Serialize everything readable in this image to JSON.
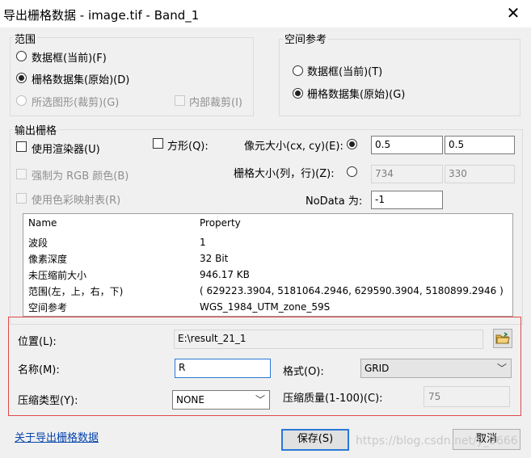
{
  "window": {
    "title": "导出栅格数据 - image.tif - Band_1",
    "close_glyph": "✕"
  },
  "extent": {
    "label": "范围",
    "data_frame": "数据框(当前)(F)",
    "raster_dataset": "栅格数据集(原始)(D)",
    "selected_graphics": "所选图形(裁剪)(G)",
    "internal_clip": "内部裁剪(I)"
  },
  "spatial_ref": {
    "label": "空间参考",
    "data_frame": "数据框(当前)(T)",
    "raster_dataset": "栅格数据集(原始)(G)"
  },
  "output": {
    "label": "输出栅格",
    "use_renderer": "使用渲染器(U)",
    "square": "方形(Q):",
    "cell_size_label": "像元大小(cx, cy)(E):",
    "cell_x": "0.5",
    "cell_y": "0.5",
    "force_rgb": "强制为 RGB 颜色(B)",
    "raster_size_label": "栅格大小(列，行)(Z):",
    "cols": "734",
    "rows": "330",
    "use_colormap": "使用色彩映射表(R)",
    "nodata_label": "NoData 为:",
    "nodata_value": "-1"
  },
  "props": {
    "headers": {
      "name": "Name",
      "property": "Property"
    },
    "rows": [
      {
        "name": "波段",
        "value": "1"
      },
      {
        "name": "像素深度",
        "value": "32 Bit"
      },
      {
        "name": "未压缩前大小",
        "value": "946.17 KB"
      },
      {
        "name": "范围(左，上，右，下)",
        "value": "( 629223.3904, 5181064.2946, 629590.3904, 5180899.2946 )"
      },
      {
        "name": "空间参考",
        "value": "WGS_1984_UTM_zone_59S"
      }
    ]
  },
  "save": {
    "location_label": "位置(L):",
    "location_value": "E:\\result_21_1",
    "name_label": "名称(M):",
    "name_value": "R",
    "format_label": "格式(O):",
    "format_value": "GRID",
    "compression_label": "压缩类型(Y):",
    "compression_value": "NONE",
    "quality_label": "压缩质量(1-100)(C):",
    "quality_value": "75"
  },
  "footer": {
    "about_link": "关于导出栅格数据",
    "save_button": "保存(S)",
    "cancel_button": "取消",
    "watermark": "https://blog.csdn.net/y_3666"
  },
  "colors": {
    "highlight_border": "#e04848",
    "default_button_border": "#2a78d6",
    "link": "#0645ad"
  }
}
